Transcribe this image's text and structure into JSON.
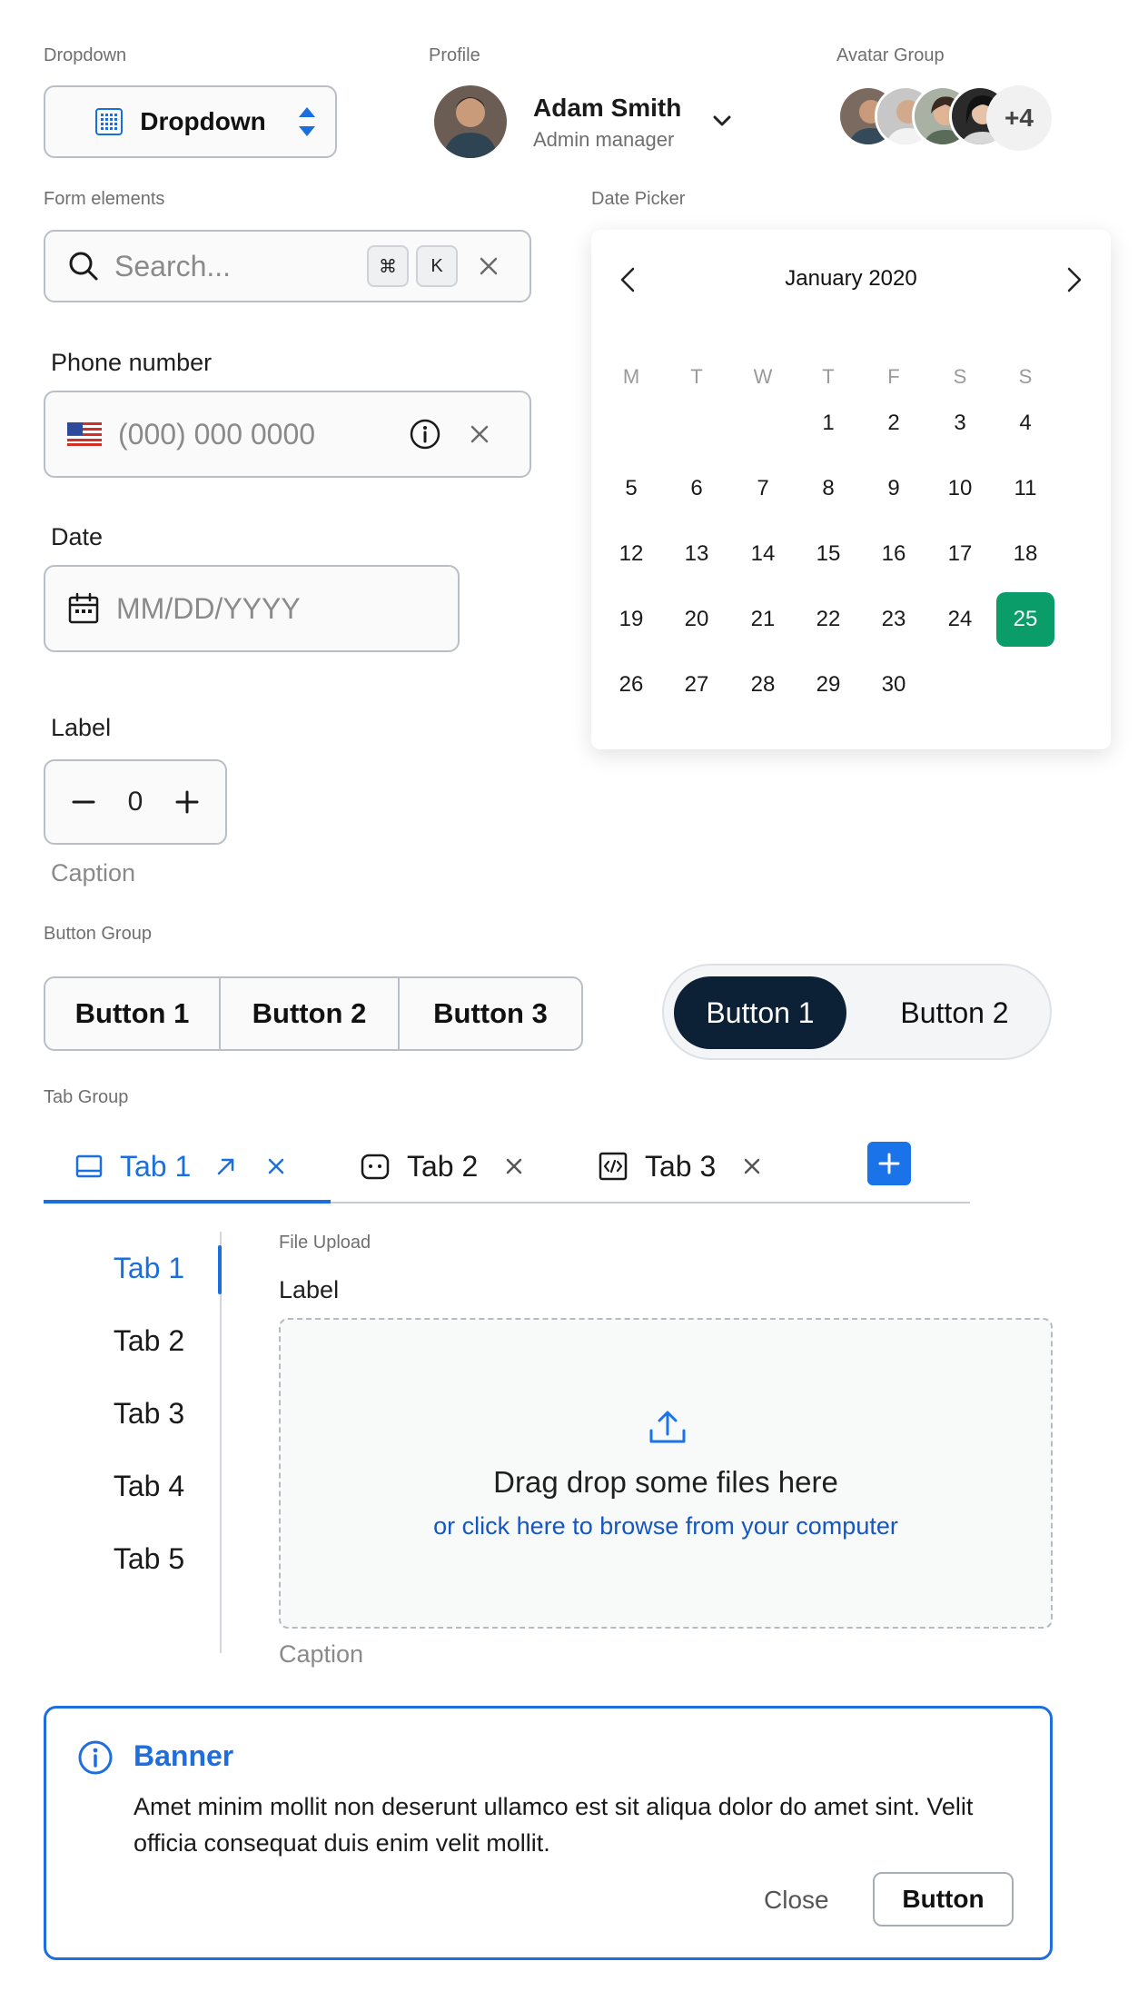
{
  "sections": {
    "dropdown": "Dropdown",
    "profile": "Profile",
    "avatar_group": "Avatar Group",
    "form_elements": "Form elements",
    "date_picker": "Date Picker",
    "button_group": "Button Group",
    "tab_group": "Tab Group",
    "file_upload": "File Upload"
  },
  "dropdown": {
    "label": "Dropdown",
    "icon": "grid-icon"
  },
  "profile": {
    "name": "Adam Smith",
    "role": "Admin manager"
  },
  "avatar_group": {
    "more": "+4"
  },
  "search": {
    "placeholder": "Search...",
    "shortcut_cmd": "⌘",
    "shortcut_key": "K"
  },
  "phone": {
    "label": "Phone number",
    "placeholder": "(000) 000 0000"
  },
  "date": {
    "label": "Date",
    "placeholder": "MM/DD/YYYY"
  },
  "stepper": {
    "label": "Label",
    "value": "0",
    "caption": "Caption"
  },
  "calendar": {
    "title": "January 2020",
    "weekdays": [
      "M",
      "T",
      "W",
      "T",
      "F",
      "S",
      "S"
    ],
    "selected": "25",
    "accent": "#0a9d6a",
    "weeks": [
      [
        "",
        "",
        "",
        "1",
        "2",
        "3",
        "4"
      ],
      [
        "5",
        "6",
        "7",
        "8",
        "9",
        "10",
        "11"
      ],
      [
        "12",
        "13",
        "14",
        "15",
        "16",
        "17",
        "18"
      ],
      [
        "19",
        "20",
        "21",
        "22",
        "23",
        "24",
        "25"
      ],
      [
        "26",
        "27",
        "28",
        "29",
        "30",
        "",
        ""
      ]
    ]
  },
  "button_group": {
    "b1": "Button 1",
    "b2": "Button 2",
    "b3": "Button 3"
  },
  "pill_group": {
    "b1": "Button 1",
    "b2": "Button 2"
  },
  "tabs": [
    {
      "label": "Tab 1"
    },
    {
      "label": "Tab 2"
    },
    {
      "label": "Tab 3"
    }
  ],
  "vertical_tabs": [
    "Tab 1",
    "Tab 2",
    "Tab 3",
    "Tab 4",
    "Tab 5"
  ],
  "file_upload": {
    "label": "Label",
    "title": "Drag drop some files here",
    "link": "or click here to browse from your computer",
    "caption": "Caption"
  },
  "banner": {
    "title": "Banner",
    "body": "Amet minim mollit non deserunt ullamco est sit aliqua dolor do amet sint. Velit officia consequat duis enim velit mollit.",
    "close": "Close",
    "button": "Button"
  },
  "colors": {
    "primary": "#1a6fe0",
    "dark": "#0c2136",
    "success": "#0a9d6a"
  }
}
